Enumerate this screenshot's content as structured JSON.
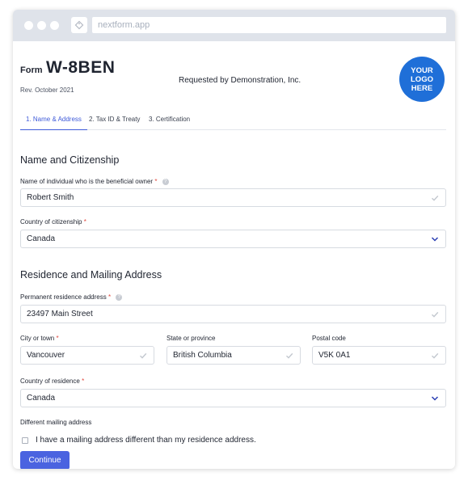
{
  "browser": {
    "url": "nextform.app"
  },
  "header": {
    "form_label": "Form",
    "form_code": "W-8BEN",
    "revision": "Rev. October 2021",
    "requested_by": "Requested by Demonstration, Inc.",
    "logo_lines": [
      "YOUR",
      "LOGO",
      "HERE"
    ]
  },
  "tabs": [
    {
      "label": "1. Name & Address",
      "active": true
    },
    {
      "label": "2. Tax ID & Treaty",
      "active": false
    },
    {
      "label": "3. Certification",
      "active": false
    }
  ],
  "sections": {
    "name_citizenship": "Name and Citizenship",
    "residence_mailing": "Residence and Mailing Address"
  },
  "fields": {
    "beneficial_owner": {
      "label": "Name of individual who is the beneficial owner",
      "required": "*",
      "value": "Robert Smith"
    },
    "citizenship": {
      "label": "Country of citizenship",
      "required": "*",
      "value": "Canada"
    },
    "permanent_address": {
      "label": "Permanent residence address",
      "required": "*",
      "value": "23497 Main Street"
    },
    "city": {
      "label": "City or town",
      "required": "*",
      "value": "Vancouver"
    },
    "state": {
      "label": "State or province",
      "value": "British Columbia"
    },
    "postal": {
      "label": "Postal code",
      "value": "V5K 0A1"
    },
    "residence_country": {
      "label": "Country of residence",
      "required": "*",
      "value": "Canada"
    },
    "mailing": {
      "label": "Different mailing address",
      "checkbox_label": "I have a mailing address different than my residence address.",
      "checked": false
    }
  },
  "actions": {
    "continue_label": "Continue"
  },
  "colors": {
    "accent": "#4a63e0",
    "logo": "#1f6fd8",
    "required": "#e0483e",
    "check": "#c3c8cf"
  },
  "icons": {
    "help": "?"
  }
}
